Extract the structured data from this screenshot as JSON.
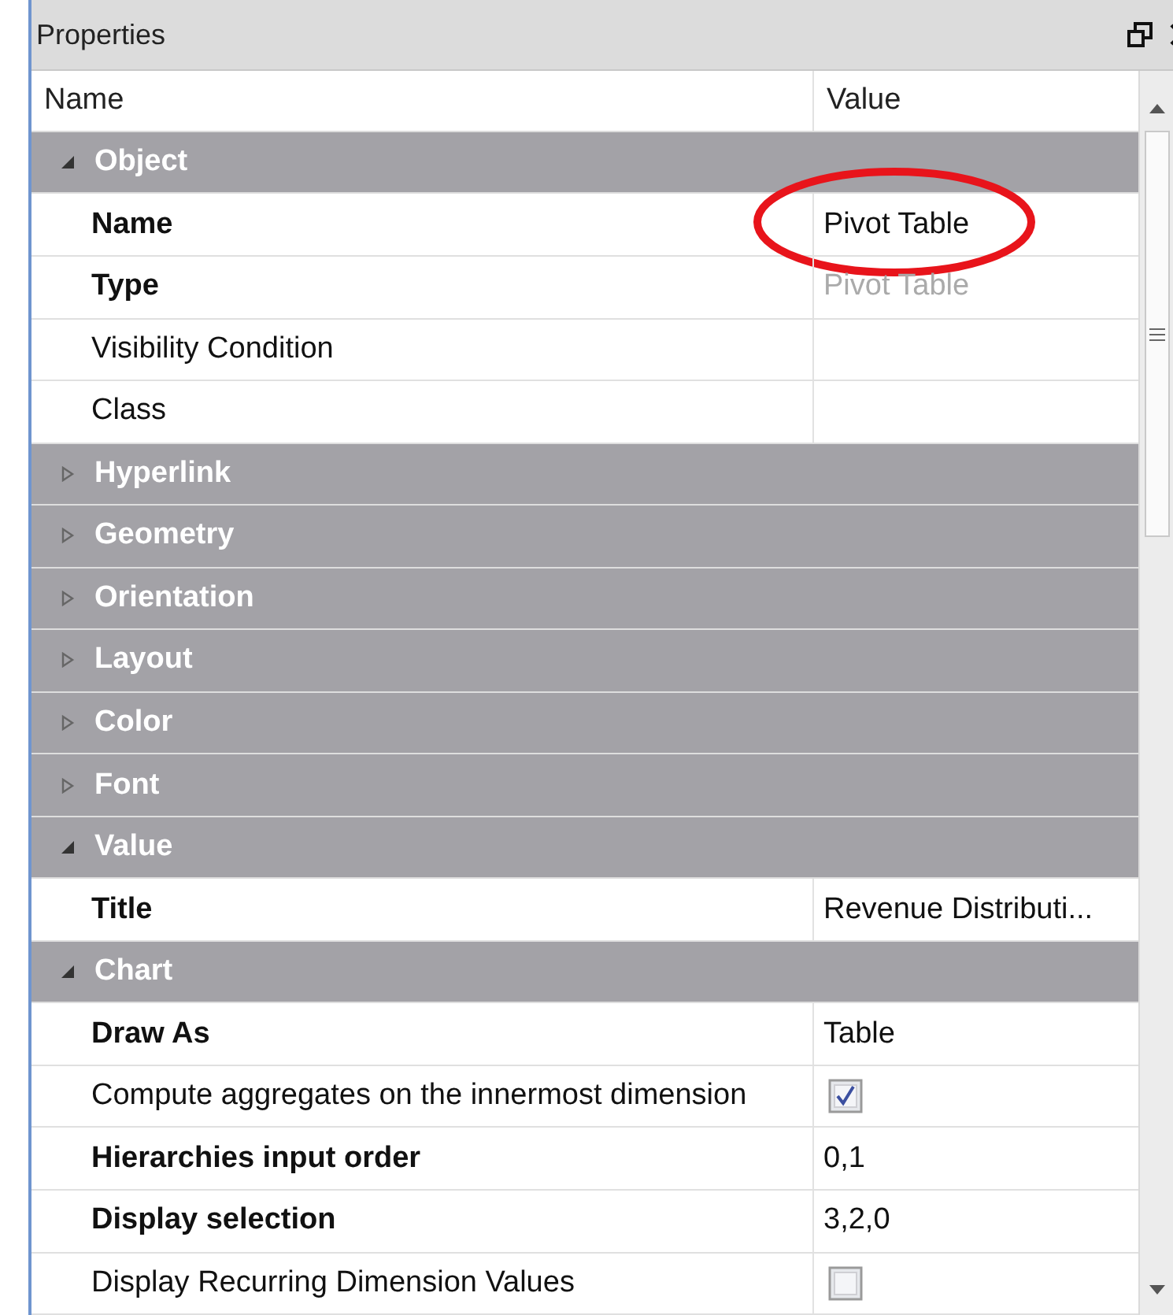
{
  "window": {
    "title": "Properties"
  },
  "columns": [
    "Name",
    "Value"
  ],
  "rows": [
    {
      "kind": "group",
      "label": "Object",
      "expanded": true
    },
    {
      "kind": "property",
      "label": "Name",
      "bold": true,
      "value": "Pivot Table",
      "disabled": false,
      "highlighted": true
    },
    {
      "kind": "property",
      "label": "Type",
      "bold": true,
      "value": "Pivot Table",
      "disabled": true,
      "highlighted": false
    },
    {
      "kind": "property",
      "label": "Visibility Condition",
      "bold": false
    },
    {
      "kind": "property",
      "label": "Class",
      "bold": false
    },
    {
      "kind": "group",
      "label": "Hyperlink",
      "expanded": false
    },
    {
      "kind": "group",
      "label": "Geometry",
      "expanded": false
    },
    {
      "kind": "group",
      "label": "Orientation",
      "expanded": false
    },
    {
      "kind": "group",
      "label": "Layout",
      "expanded": false
    },
    {
      "kind": "group",
      "label": "Color",
      "expanded": false
    },
    {
      "kind": "group",
      "label": "Font",
      "expanded": false
    },
    {
      "kind": "group",
      "label": "Value",
      "expanded": true
    },
    {
      "kind": "property",
      "label": "Title",
      "bold": true,
      "value": "Revenue Distributi...",
      "disabled": false,
      "highlighted": false
    },
    {
      "kind": "group",
      "label": "Chart",
      "expanded": true
    },
    {
      "kind": "property",
      "label": "Draw As",
      "bold": true,
      "value": "Table",
      "disabled": false,
      "highlighted": false
    },
    {
      "kind": "checkbox",
      "label": "Compute aggregates on the innermost dimension",
      "bold": false,
      "checked": true
    },
    {
      "kind": "property",
      "label": "Hierarchies input order",
      "bold": true,
      "value": "0,1",
      "disabled": false,
      "highlighted": false
    },
    {
      "kind": "property",
      "label": "Display selection",
      "bold": true,
      "value": "3,2,0",
      "disabled": false,
      "highlighted": false
    },
    {
      "kind": "checkbox",
      "label": "Display Recurring Dimension Values",
      "bold": false,
      "checked": false
    }
  ]
}
